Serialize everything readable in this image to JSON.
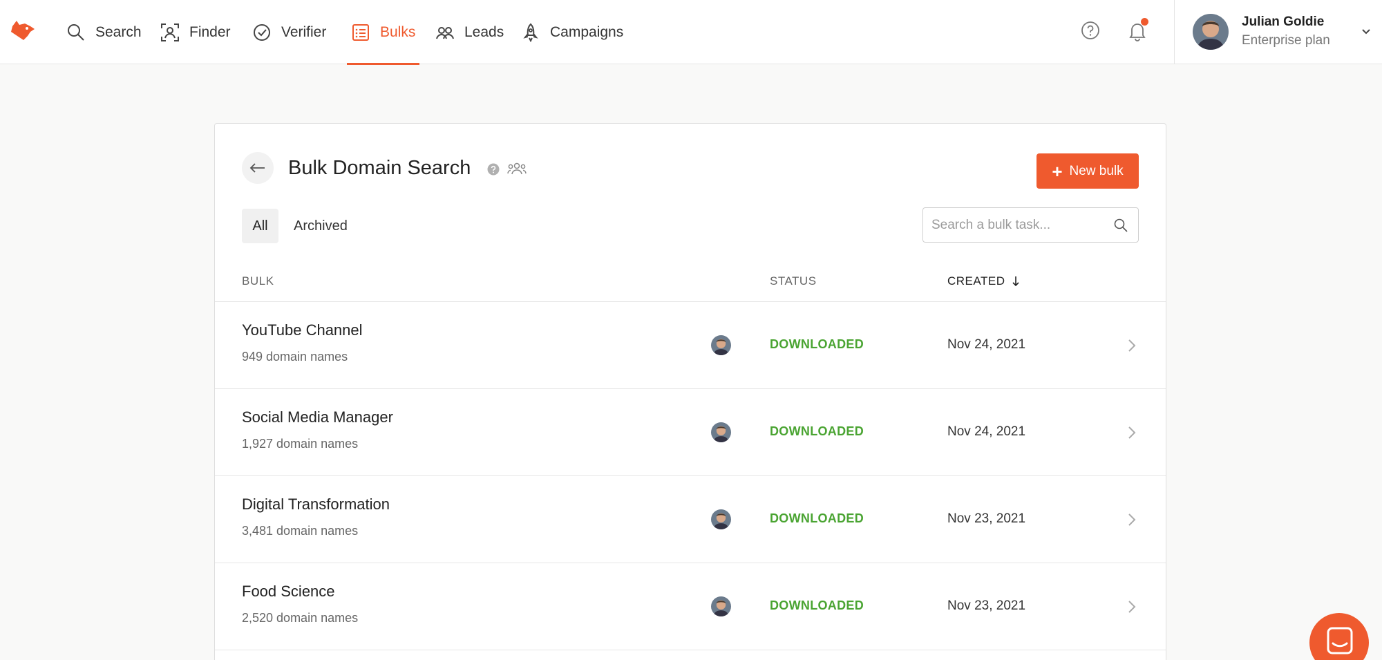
{
  "nav": {
    "items": [
      {
        "label": "Search"
      },
      {
        "label": "Finder"
      },
      {
        "label": "Verifier"
      },
      {
        "label": "Bulks"
      },
      {
        "label": "Leads"
      },
      {
        "label": "Campaigns"
      }
    ],
    "active": "Bulks"
  },
  "user": {
    "name": "Julian Goldie",
    "plan": "Enterprise plan"
  },
  "page": {
    "title": "Bulk Domain Search",
    "new_button": "New bulk",
    "tabs": [
      "All",
      "Archived"
    ],
    "search_placeholder": "Search a bulk task..."
  },
  "table": {
    "headers": {
      "bulk": "BULK",
      "status": "STATUS",
      "created": "CREATED"
    },
    "rows": [
      {
        "title": "YouTube Channel",
        "count": "949 domain names",
        "status": "DOWNLOADED",
        "date": "Nov 24, 2021"
      },
      {
        "title": "Social Media Manager",
        "count": "1,927 domain names",
        "status": "DOWNLOADED",
        "date": "Nov 24, 2021"
      },
      {
        "title": "Digital Transformation",
        "count": "3,481 domain names",
        "status": "DOWNLOADED",
        "date": "Nov 23, 2021"
      },
      {
        "title": "Food Science",
        "count": "2,520 domain names",
        "status": "DOWNLOADED",
        "date": "Nov 23, 2021"
      }
    ]
  },
  "colors": {
    "accent": "#ef5a2e",
    "status_downloaded": "#4aa432"
  }
}
